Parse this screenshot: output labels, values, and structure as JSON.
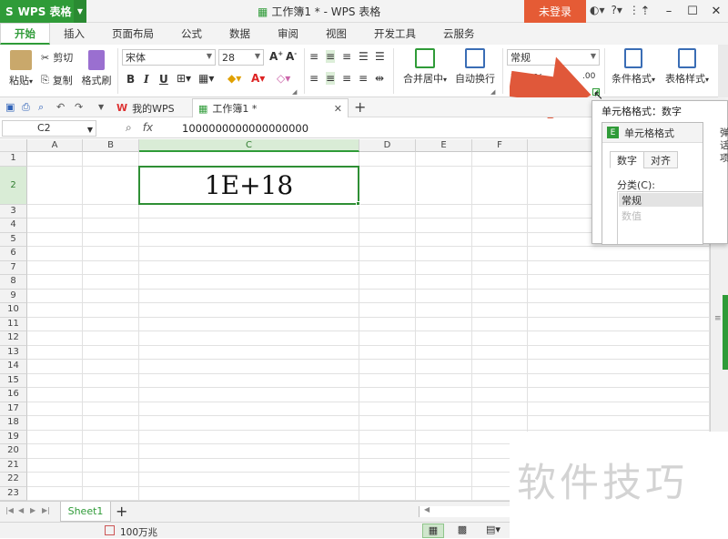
{
  "app": {
    "name": "WPS 表格",
    "window_title": "工作簿1 * - WPS 表格",
    "login_label": "未登录"
  },
  "ribbon_tabs": [
    "开始",
    "插入",
    "页面布局",
    "公式",
    "数据",
    "审阅",
    "视图",
    "开发工具",
    "云服务"
  ],
  "ribbon": {
    "paste": "粘贴",
    "cut": "剪切",
    "copy": "复制",
    "format_painter": "格式刷",
    "font_name": "宋体",
    "font_size": "28",
    "bold": "B",
    "italic": "I",
    "underline": "U",
    "merge_center": "合并居中",
    "wrap_text": "自动换行",
    "number_format": "常规",
    "percent": "%",
    "conditional_format": "条件格式",
    "table_style": "表格样式"
  },
  "doc_tabs": [
    {
      "label": "我的WPS"
    },
    {
      "label": "工作簿1 *"
    }
  ],
  "formula_bar": {
    "cell_ref": "C2",
    "fx": "fx",
    "content": "1000000000000000000"
  },
  "grid": {
    "columns": [
      "A",
      "B",
      "C",
      "D",
      "E",
      "F",
      "G"
    ],
    "rows": [
      "1",
      "2",
      "3",
      "4",
      "5",
      "6",
      "7",
      "8",
      "9",
      "10",
      "11",
      "12",
      "13",
      "14",
      "15",
      "16",
      "17",
      "18",
      "19",
      "20",
      "21",
      "22",
      "23"
    ],
    "selected_cell_value": "1E+18"
  },
  "sheet": {
    "tab": "Sheet1",
    "add": "+"
  },
  "status": {
    "unit": "100万兆"
  },
  "popup": {
    "tooltip_title": "单元格格式：数字",
    "dialog_title": "单元格格式",
    "dialog_tabs": [
      "数字",
      "对齐"
    ],
    "category_label": "分类(C):",
    "selected_category": "常规",
    "next_category": "数值",
    "side_text": [
      "弹",
      "话",
      "项"
    ]
  },
  "watermark": "软件技巧",
  "colors": {
    "accent_green": "#2f9b38",
    "login_orange": "#e55b35",
    "arrow_red": "#e0583a"
  }
}
